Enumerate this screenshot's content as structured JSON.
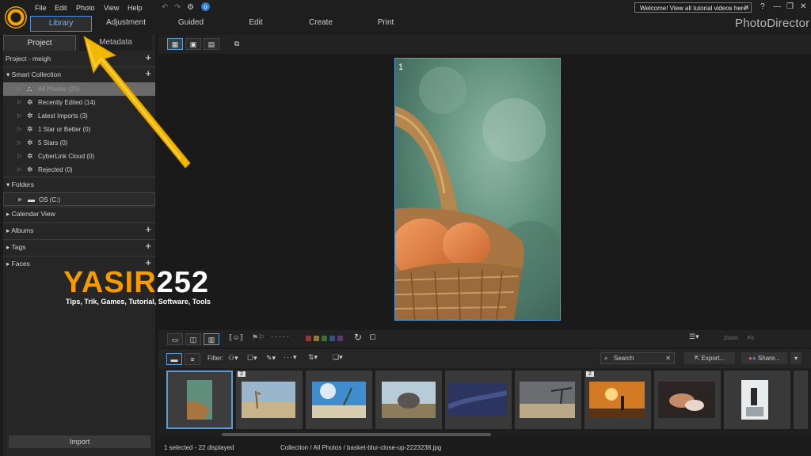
{
  "menu": [
    "File",
    "Edit",
    "Photo",
    "View",
    "Help"
  ],
  "update_badge": "o",
  "modules": [
    "Library",
    "Adjustment",
    "Guided",
    "Edit",
    "Create",
    "Print"
  ],
  "welcome_text": "Welcome! View all tutorial videos here!",
  "welcome_close": "✕",
  "window_controls": [
    "?",
    "—",
    "❐",
    "✕"
  ],
  "brand": "PhotoDirector",
  "panel_tabs": [
    "Project",
    "Metadata"
  ],
  "project_label": "Project - meigh",
  "plus": "+",
  "smart_collection": {
    "label": "Smart Collection",
    "items": [
      "All Photos (25)",
      "Recently Edited (14)",
      "Latest Imports (3)",
      "1 Star or Better (0)",
      "5 Stars (0)",
      "CyberLink Cloud (0)",
      "Rejected (0)"
    ]
  },
  "folders": {
    "label": "Folders",
    "items": [
      "OS (C:)"
    ]
  },
  "sections": [
    "Calendar View",
    "Albums",
    "Tags",
    "Faces"
  ],
  "import_label": "Import",
  "viewer": {
    "photo_number": "1"
  },
  "zoom": {
    "label": "Zoom",
    "value": "Fit"
  },
  "filter_label": "Filter:",
  "search_placeholder": "Search",
  "search_clear": "✕",
  "export_label": "Export...",
  "share_label": "Share...",
  "share_more": "▾",
  "thumbnails": [
    {
      "badge": "",
      "selected": true
    },
    {
      "badge": "2",
      "selected": false
    },
    {
      "badge": "",
      "selected": false
    },
    {
      "badge": "",
      "selected": false
    },
    {
      "badge": "",
      "selected": false
    },
    {
      "badge": "",
      "selected": false
    },
    {
      "badge": "2",
      "selected": false
    },
    {
      "badge": "",
      "selected": false
    },
    {
      "badge": "",
      "selected": false
    }
  ],
  "status": {
    "selection": "1 selected - 22 displayed",
    "path": "Collection / All Photos / basket-blur-close-up-2223238.jpg"
  },
  "watermark": {
    "title_a": "YASIR",
    "title_b": "252",
    "subtitle": "Tips, Trik, Games, Tutorial, Software, Tools"
  },
  "colors": {
    "accent": "#5b9bd8",
    "logo": "#f6a500",
    "watermark": "#f59a00"
  }
}
